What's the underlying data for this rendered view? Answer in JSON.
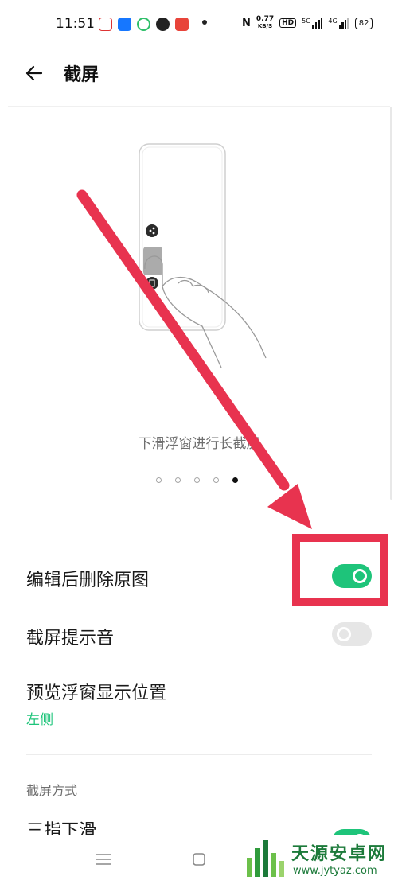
{
  "status_bar": {
    "time": "11:51",
    "net_speed_value": "0.77",
    "net_speed_unit": "KB/S",
    "hd": "HD",
    "signal1": "5G",
    "signal2": "4G",
    "battery": "82"
  },
  "header": {
    "title": "截屏"
  },
  "preview": {
    "caption": "下滑浮窗进行长截屏",
    "pages_total": 5,
    "active_page": 5
  },
  "settings": {
    "delete_original": {
      "label": "编辑后删除原图",
      "enabled": true
    },
    "shutter_sound": {
      "label": "截屏提示音",
      "enabled": false
    },
    "preview_position": {
      "label": "预览浮窗显示位置",
      "value": "左侧"
    }
  },
  "section": {
    "header": "截屏方式"
  },
  "methods": {
    "three_finger": {
      "label": "三指下滑",
      "enabled": true
    }
  },
  "watermark": {
    "brand": "天源安卓网",
    "url": "www.jytyaz.com"
  },
  "colors": {
    "accent": "#1ec47a",
    "annotation": "#e8334f",
    "toggle_off": "#e6e6e6"
  }
}
